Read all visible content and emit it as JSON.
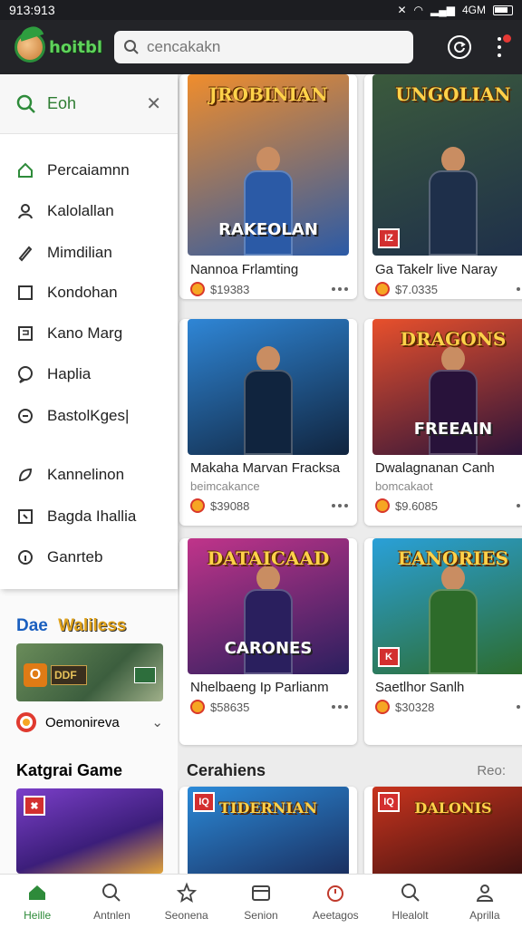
{
  "status": {
    "time": "913:913",
    "right": "4GM"
  },
  "header": {
    "logo_text": "hoitbl",
    "search_placeholder": "cencakakn"
  },
  "drawer": {
    "title": "Eoh",
    "items": [
      {
        "label": "Percaiamnn",
        "icon": "home-icon"
      },
      {
        "label": "Kalolallan",
        "icon": "user-icon"
      },
      {
        "label": "Mimdilian",
        "icon": "pen-icon"
      },
      {
        "label": "Kondohan",
        "icon": "square-icon"
      },
      {
        "label": "Kano Marg",
        "icon": "flag-icon"
      },
      {
        "label": "Haplia",
        "icon": "chat-icon"
      },
      {
        "label": "BastolKges|",
        "icon": "message-icon"
      },
      {
        "label": "Kannelinon",
        "icon": "leaf-icon"
      },
      {
        "label": "Bagda Ihallia",
        "icon": "bookmark-icon"
      },
      {
        "label": "Ganrteb",
        "icon": "info-icon"
      }
    ]
  },
  "left_panel": {
    "wallet_prefix": "Dae",
    "wallet_title": "Waliless",
    "promo_label": "DDF",
    "account_label": "Oemonireva",
    "category_title": "Katgrai Game"
  },
  "cards": [
    {
      "art_title": "JROBINIAN",
      "art_sub": "RAKEOLAN",
      "title": "Nannoa Frlamting",
      "price": "$19383",
      "colors": [
        "#f08d2c",
        "#2b5aa6"
      ]
    },
    {
      "art_title": "UNGOLIAN",
      "art_sub": "",
      "badge": "IZ",
      "title": "Ga Takelr live Naray",
      "price": "$7.0335",
      "colors": [
        "#3b5a3c",
        "#1e2f4a"
      ]
    },
    {
      "art_title": "",
      "art_sub": "",
      "title": "Makaha Marvan Fracksa",
      "subtitle": "beimcakance",
      "price": "$39088",
      "colors": [
        "#2f86d6",
        "#10243e"
      ]
    },
    {
      "art_title": "DRAGONS",
      "art_sub": "FREEAIN",
      "title": "Dwalagnanan Canh",
      "subtitle": "bomcakaot",
      "price": "$9.6085",
      "colors": [
        "#e8502c",
        "#28123a"
      ]
    },
    {
      "art_title": "DATAICAAD",
      "art_sub": "CARONES",
      "title": "Nhelbaeng Ip Parlianm",
      "price": "$58635",
      "colors": [
        "#c0348a",
        "#2a1f5e"
      ]
    },
    {
      "art_title": "EANORIES",
      "art_sub": "",
      "badge": "K",
      "title": "Saetlhor Sanlh",
      "price": "$30328",
      "colors": [
        "#2aa0d8",
        "#2d6b2a"
      ]
    }
  ],
  "section": {
    "title": "Cerahiens",
    "link": "Reo:"
  },
  "bottom_cards": [
    {
      "art_title": "TIDERNIAN",
      "badge": "IQ"
    },
    {
      "art_title": "DALONIS",
      "badge": "IQ"
    }
  ],
  "nav": [
    {
      "label": "Heille",
      "icon": "home-icon"
    },
    {
      "label": "Antnlen",
      "icon": "search-icon"
    },
    {
      "label": "Seonena",
      "icon": "star-icon"
    },
    {
      "label": "Senion",
      "icon": "box-icon"
    },
    {
      "label": "Aeetagos",
      "icon": "timer-icon"
    },
    {
      "label": "Hlealolt",
      "icon": "search-icon"
    },
    {
      "label": "Aprilla",
      "icon": "person-icon"
    }
  ],
  "colors": {
    "accent": "#2e8b3a",
    "topbar": "#232428",
    "badge_red": "#d32f2f",
    "coin": "#f6a623"
  }
}
